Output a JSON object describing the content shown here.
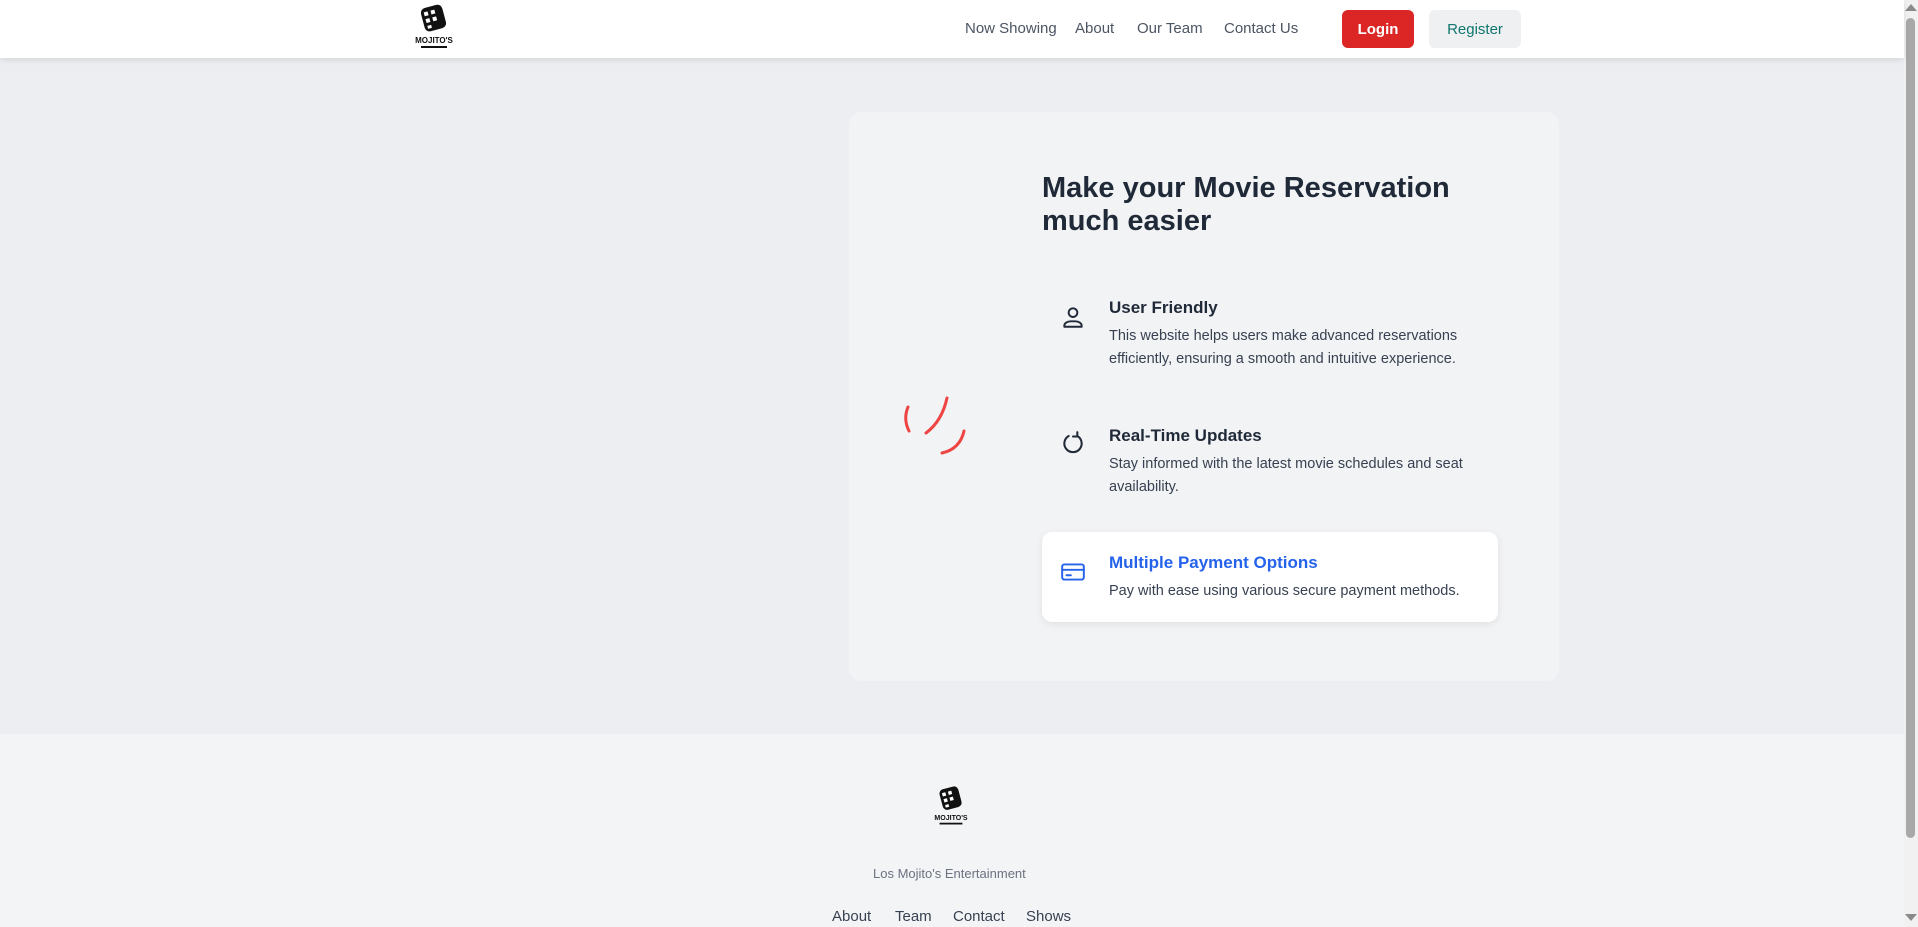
{
  "header": {
    "logo_name": "logo-icon",
    "nav": [
      "Now Showing",
      "About",
      "Our Team",
      "Contact Us"
    ],
    "login_label": "Login",
    "register_label": "Register"
  },
  "colors": {
    "accent_red": "#dc2626",
    "register_text": "#0f766e",
    "active_blue": "#2563eb",
    "page_bg": "#eceef2"
  },
  "main": {
    "headline": "Make your Movie Reservation much easier",
    "loading_icon": "loading-spinner-icon",
    "features": [
      {
        "icon": "user-icon",
        "title": "User Friendly",
        "description": "This website helps users make advanced reservations efficiently, ensuring a smooth and intuitive experience."
      },
      {
        "icon": "refresh-icon",
        "title": "Real-Time Updates",
        "description": "Stay informed with the latest movie schedules and seat availability."
      },
      {
        "icon": "credit-card-icon",
        "title": "Multiple Payment Options",
        "description": "Pay with ease using various secure payment methods."
      }
    ]
  },
  "footer": {
    "company": "Los Mojito's Entertainment",
    "links": [
      "About",
      "Team",
      "Contact",
      "Shows"
    ]
  }
}
